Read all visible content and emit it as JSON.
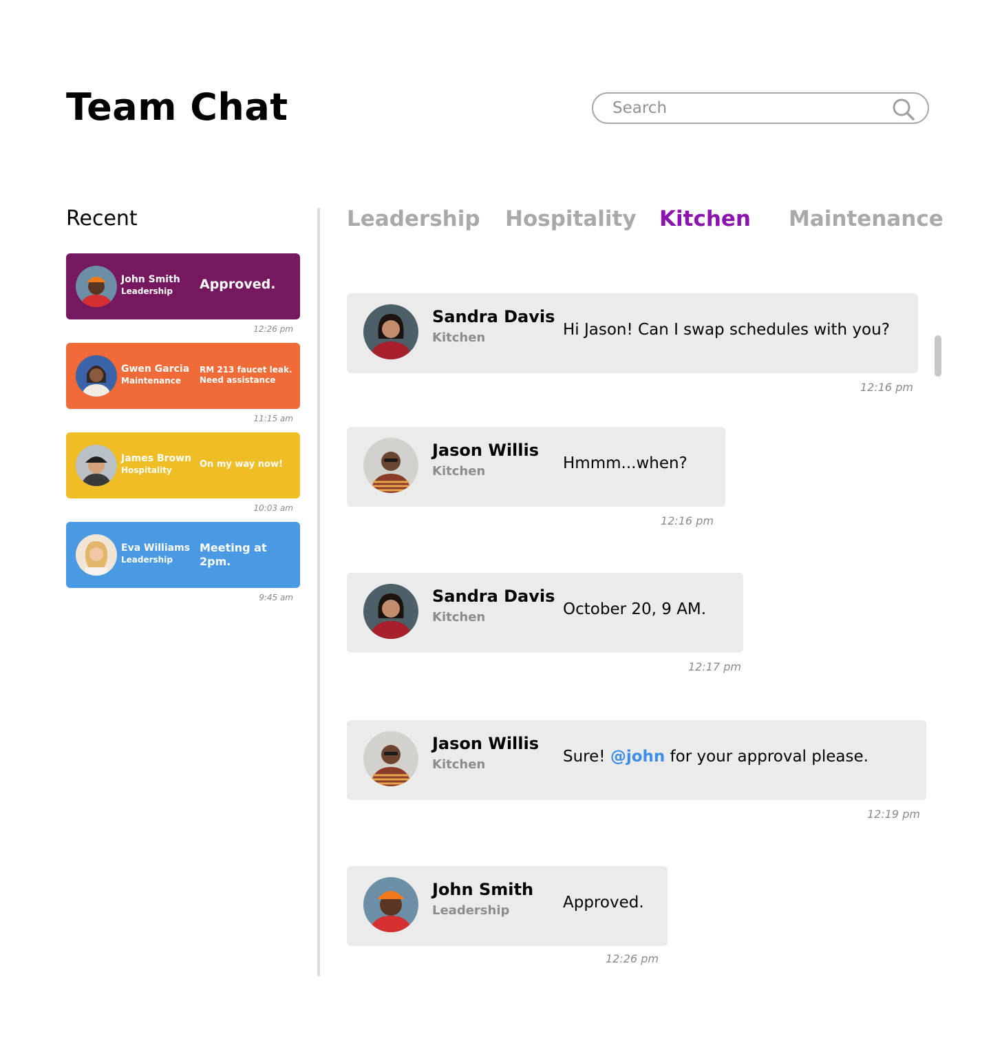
{
  "header": {
    "title": "Team Chat"
  },
  "search": {
    "placeholder": "Search",
    "icon": "search-icon"
  },
  "recent": {
    "heading": "Recent",
    "items": [
      {
        "name": "John Smith",
        "dept": "Leadership",
        "message": "Approved.",
        "time": "12:26 pm",
        "color": "#76185f"
      },
      {
        "name": "Gwen Garcia",
        "dept": "Maintenance",
        "message": "RM 213 faucet leak. Need assistance",
        "time": "11:15 am",
        "color": "#f06b37"
      },
      {
        "name": "James Brown",
        "dept": "Hospitality",
        "message": "On my way now!",
        "time": "10:03 am",
        "color": "#efbd26"
      },
      {
        "name": "Eva Williams",
        "dept": "Leadership",
        "message": "Meeting at 2pm.",
        "time": "9:45 am",
        "color": "#4a9ae3"
      }
    ]
  },
  "tabs": [
    {
      "label": "Leadership",
      "active": false
    },
    {
      "label": "Hospitality",
      "active": false
    },
    {
      "label": "Kitchen",
      "active": true
    },
    {
      "label": "Maintenance",
      "active": false
    }
  ],
  "accent_color": "#8a14ad",
  "messages": [
    {
      "name": "Sandra Davis",
      "dept": "Kitchen",
      "text": "Hi Jason! Can I swap schedules with you?",
      "time": "12:16 pm"
    },
    {
      "name": "Jason Willis",
      "dept": "Kitchen",
      "text": "Hmmm...when?",
      "time": "12:16 pm"
    },
    {
      "name": "Sandra Davis",
      "dept": "Kitchen",
      "text": "October 20, 9 AM.",
      "time": "12:17 pm"
    },
    {
      "name": "Jason Willis",
      "dept": "Kitchen",
      "text_before": "Sure! ",
      "mention": "@john",
      "text_after": " for your approval please.",
      "time": "12:19 pm"
    },
    {
      "name": "John Smith",
      "dept": "Leadership",
      "text": "Approved.",
      "time": "12:26 pm"
    }
  ]
}
